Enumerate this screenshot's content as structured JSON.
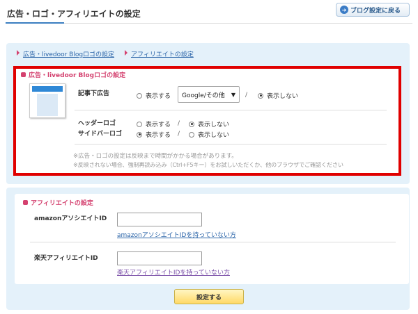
{
  "header": {
    "title": "広告・ロゴ・アフィリエイトの設定",
    "back_button": "ブログ設定に戻る"
  },
  "breadcrumb": {
    "items": [
      "広告・livedoor Blogロゴの設定",
      "アフィリエイトの設定"
    ]
  },
  "ad_section": {
    "title": "広告・livedoor Blogロゴの設定",
    "article_ad": {
      "label": "記事下広告",
      "show": "表示する",
      "select_value": "Google/その他",
      "hide": "表示しない",
      "slash": "/"
    },
    "header_logo": {
      "label": "ヘッダーロゴ",
      "show": "表示する",
      "hide": "表示しない",
      "slash": "/"
    },
    "sidebar_logo": {
      "label": "サイドバーロゴ",
      "show": "表示する",
      "hide": "表示しない",
      "slash": "/"
    },
    "notes": [
      "※広告・ロゴの設定は反映まで時間がかかる場合があります。",
      "※反映されない場合、強制再読み込み（Ctrl+F5キー）をお試しいただくか、他のブラウザでご確認ください"
    ]
  },
  "affiliate_section": {
    "title": "アフィリエイトの設定",
    "amazon": {
      "label": "amazonアソシエイトID",
      "value": "",
      "link": "amazonアソシエイトIDを持っていない方"
    },
    "rakuten": {
      "label": "楽天アフィリエイトID",
      "value": "",
      "link": "楽天アフィリエイトIDを持っていない方"
    }
  },
  "submit_label": "設定する",
  "colors": {
    "accent_pink": "#d4416f",
    "link_blue": "#2a64a8",
    "panel_bg": "#e4f1fa",
    "highlight_red": "#e00000",
    "submit_yellow": "#ffd966"
  },
  "icons": {
    "back": "arrow-circle-icon",
    "section_marker": "square-bullet-icon",
    "breadcrumb_marker": "triangle-right-icon"
  }
}
